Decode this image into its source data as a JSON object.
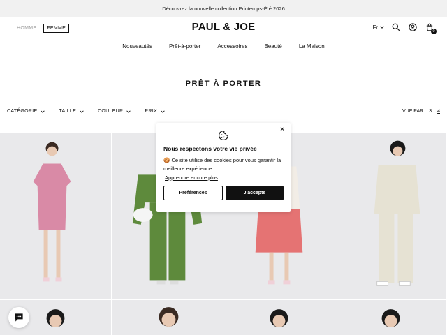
{
  "announcement": "Découvrez la nouvelle collection Printemps-Été 2026",
  "segments": {
    "home": "HOMME",
    "women": "FEMME"
  },
  "logo": "PAUL & JOE",
  "language": "Fr",
  "cart_count": "0",
  "nav": [
    "Nouveautés",
    "Prêt-à-porter",
    "Accessoires",
    "Beauté",
    "La Maison"
  ],
  "page_title": "PRÊT À PORTER",
  "filters": [
    "CATÉGORIE",
    "TAILLE",
    "COULEUR",
    "PRIX"
  ],
  "view_by": {
    "label": "VUE PAR",
    "options": [
      "3",
      "4"
    ],
    "active": "4"
  },
  "cookie": {
    "title": "Nous respectons votre vie privée",
    "text": "Ce site utilise des cookies pour vous garantir la meilleure expérience.",
    "more": "Apprendre encore plus",
    "preferences": "Préférences",
    "accept": "J'accepte"
  },
  "products": [
    {
      "icon": "model-pink-floral-dress",
      "dress": "#d98aa6"
    },
    {
      "icon": "model-green-suit",
      "dress": "#5e8a3c"
    },
    {
      "icon": "model-red-floral-skirt",
      "dress": "#e57373"
    },
    {
      "icon": "model-floral-suit",
      "dress": "#e6e2d3"
    }
  ]
}
